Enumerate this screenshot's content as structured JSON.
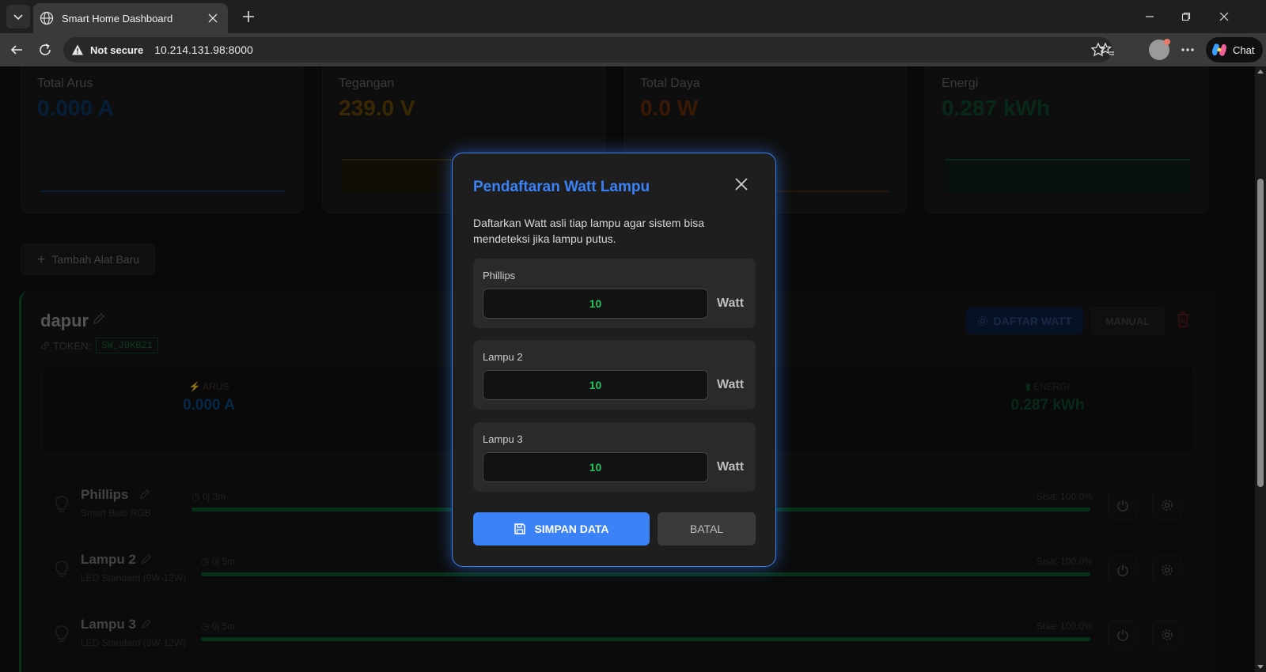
{
  "browser": {
    "tab_title": "Smart Home Dashboard",
    "security_label": "Not secure",
    "url": "10.214.131.98:8000",
    "chat_label": "Chat"
  },
  "summary": {
    "cards": [
      {
        "label": "Total Arus",
        "value": "0.000 A",
        "color": "#0a3a66"
      },
      {
        "label": "Tegangan",
        "value": "239.0 V",
        "color": "#6b4a08"
      },
      {
        "label": "Total Daya",
        "value": "0.0 W",
        "color": "#6b3008"
      },
      {
        "label": "Energi",
        "value": "0.287 kWh",
        "color": "#0f4a2c"
      }
    ]
  },
  "add_device_label": "Tambah Alat Baru",
  "room": {
    "name": "dapur",
    "token_label": "TOKEN:",
    "token_code": "SW_J8KB21",
    "daftar_watt_label": "DAFTAR WATT",
    "manual_label": "MANUAL",
    "stats": [
      {
        "label": "ARUS",
        "value": "0.000 A"
      },
      {
        "label": "ENERGI",
        "value": "0.287 kWh"
      }
    ],
    "devices": [
      {
        "name": "Phillips",
        "type": "Smart Bulb RGB",
        "time": "0j 3m",
        "sisa": "Sisa: 100.0%",
        "remaining_pct": 100
      },
      {
        "name": "Lampu 2",
        "type": "LED Standard (9W-12W)",
        "time": "0j 5m",
        "sisa": "Sisa: 100.0%",
        "remaining_pct": 100
      },
      {
        "name": "Lampu 3",
        "type": "LED Standard (9W-12W)",
        "time": "0j 5m",
        "sisa": "Sisa: 100.0%",
        "remaining_pct": 100
      }
    ]
  },
  "modal": {
    "title": "Pendaftaran Watt Lampu",
    "description": "Daftarkan Watt asli tiap lampu agar sistem bisa mendeteksi jika lampu putus.",
    "lamps": [
      {
        "label": "Phillips",
        "value": "10",
        "unit": "Watt"
      },
      {
        "label": "Lampu 2",
        "value": "10",
        "unit": "Watt"
      },
      {
        "label": "Lampu 3",
        "value": "10",
        "unit": "Watt"
      }
    ],
    "save_label": "SIMPAN DATA",
    "cancel_label": "BATAL"
  },
  "colors": {
    "accent": "#3b82f6",
    "success": "#22c55e",
    "danger": "#ef4444"
  },
  "icons": [
    "tab-list-icon",
    "globe-icon",
    "close-icon",
    "plus-icon",
    "back-icon",
    "reload-icon",
    "warning-icon",
    "star-icon",
    "favorites-icon",
    "more-icon",
    "copilot-icon",
    "pencil-icon",
    "link-icon",
    "gear-icon",
    "trash-icon",
    "bolt-icon",
    "battery-icon",
    "bulb-icon",
    "clock-icon",
    "power-icon",
    "save-icon"
  ]
}
